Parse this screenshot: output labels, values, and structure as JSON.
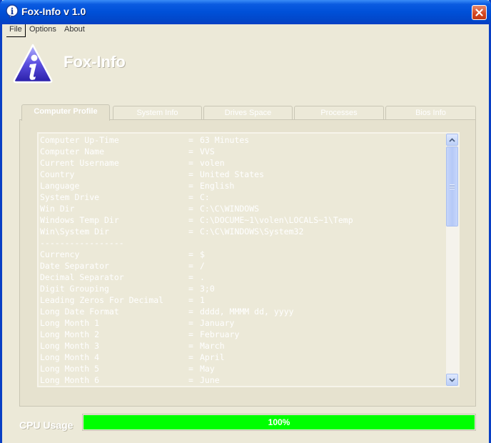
{
  "window": {
    "title": "Fox-Info v 1.0"
  },
  "menu": {
    "file": "File",
    "options": "Options",
    "about": "About"
  },
  "header": {
    "app_name": "Fox-Info"
  },
  "tabs": [
    {
      "label": "Computer Profile",
      "active": true
    },
    {
      "label": "System Info",
      "active": false
    },
    {
      "label": "Drives Space",
      "active": false
    },
    {
      "label": "Processes",
      "active": false
    },
    {
      "label": "Bios Info",
      "active": false
    }
  ],
  "profile_lines": [
    {
      "key": "Computer Up-Time",
      "sep": "=",
      "value": "63 Minutes"
    },
    {
      "key": "Computer Name",
      "sep": "=",
      "value": "VVS"
    },
    {
      "key": "Current Username",
      "sep": "=",
      "value": "volen"
    },
    {
      "key": "Country",
      "sep": "=",
      "value": "United States"
    },
    {
      "key": "Language",
      "sep": "=",
      "value": "English"
    },
    {
      "key": "System Drive",
      "sep": "=",
      "value": "C:"
    },
    {
      "key": "Win Dir",
      "sep": "=",
      "value": "C:\\C\\WINDOWS"
    },
    {
      "key": "Windows Temp Dir",
      "sep": "=",
      "value": "C:\\DOCUME~1\\volen\\LOCALS~1\\Temp"
    },
    {
      "key": "Win\\System Dir",
      "sep": "=",
      "value": "C:\\C\\WINDOWS\\System32"
    },
    {
      "key": "-----------------",
      "sep": "",
      "value": ""
    },
    {
      "key": "Currency",
      "sep": "=",
      "value": "$"
    },
    {
      "key": "Date Separator",
      "sep": "=",
      "value": "/"
    },
    {
      "key": "Decimal Separator",
      "sep": "=",
      "value": "."
    },
    {
      "key": "Digit Grouping",
      "sep": "=",
      "value": "3;0"
    },
    {
      "key": "Leading Zeros For Decimal",
      "sep": "=",
      "value": "1"
    },
    {
      "key": "Long Date Format",
      "sep": "=",
      "value": "dddd, MMMM dd, yyyy"
    },
    {
      "key": "Long Month 1",
      "sep": "=",
      "value": "January"
    },
    {
      "key": "Long Month 2",
      "sep": "=",
      "value": "February"
    },
    {
      "key": "Long Month 3",
      "sep": "=",
      "value": "March"
    },
    {
      "key": "Long Month 4",
      "sep": "=",
      "value": "April"
    },
    {
      "key": "Long Month 5",
      "sep": "=",
      "value": "May"
    },
    {
      "key": "Long Month 6",
      "sep": "=",
      "value": "June"
    }
  ],
  "cpu": {
    "label": "CPU Usage",
    "percent_text": "100%",
    "fraction": 1.0,
    "fill_color": "#00ff00"
  },
  "colors": {
    "titlebar": "#0050d8",
    "close_button": "#d2451f",
    "window_bg": "#ece9d8",
    "scrollbar": "#bcd0f8"
  }
}
